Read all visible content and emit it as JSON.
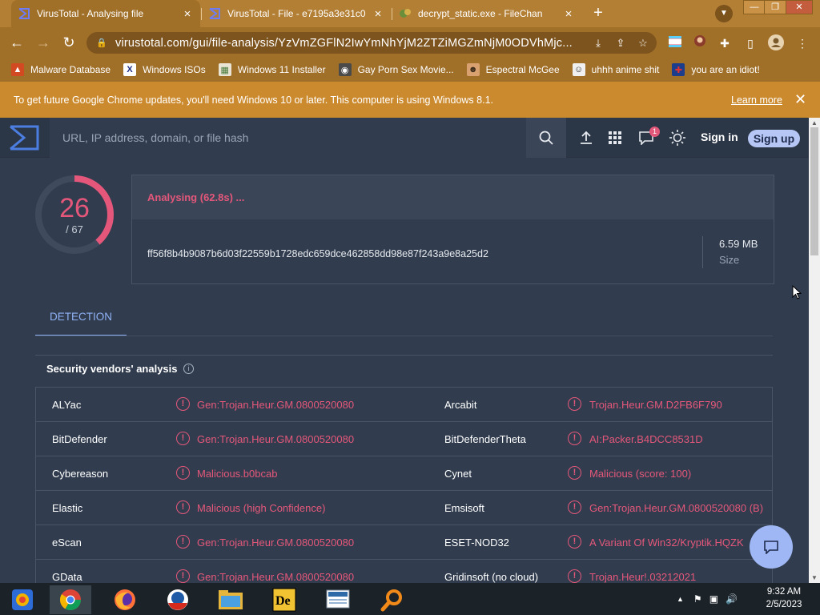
{
  "browser": {
    "tabs": [
      {
        "title": "VirusTotal - Analysing file",
        "close": "×"
      },
      {
        "title": "VirusTotal - File - e7195a3e31c0",
        "close": "×"
      },
      {
        "title": "decrypt_static.exe - FileChan",
        "close": "×"
      }
    ],
    "new_tab": "+",
    "window_controls": {
      "minimize": "—",
      "maximize": "❐",
      "close": "✕"
    },
    "address": "virustotal.com/gui/file-analysis/YzVmZGFlN2IwYmNhYjM2ZTZiMGZmNjM0ODVhMjc...",
    "bookmarks": [
      {
        "label": "Malware Database",
        "icon": "flame-icon"
      },
      {
        "label": "Windows ISOs",
        "icon": "x-icon"
      },
      {
        "label": "Windows 11 Installer",
        "icon": "image-icon"
      },
      {
        "label": "Gay Porn Sex Movie...",
        "icon": "site-icon"
      },
      {
        "label": "Espectral McGee",
        "icon": "face-icon"
      },
      {
        "label": "uhhh anime shit",
        "icon": "face-icon"
      },
      {
        "label": "you are an idiot!",
        "icon": "flag-icon"
      }
    ],
    "infobar": {
      "message": "To get future Google Chrome updates, you'll need Windows 10 or later. This computer is using Windows 8.1.",
      "learn_more": "Learn more",
      "close": "✕"
    }
  },
  "vt": {
    "search_placeholder": "URL, IP address, domain, or file hash",
    "notification_count": "1",
    "sign_in": "Sign in",
    "sign_up": "Sign up",
    "score": {
      "detected": "26",
      "total": "/ 67",
      "fraction": 0.388
    },
    "status": "Analysing (62.8s) ...",
    "hash": "ff56f8b4b9087b6d03f22559b1728edc659dce462858dd98e87f243a9e8a25d2",
    "size_value": "6.59 MB",
    "size_label": "Size",
    "tab_detection": "DETECTION",
    "vendors_title": "Security vendors' analysis",
    "rows": [
      {
        "v1": "ALYac",
        "r1": "Gen:Trojan.Heur.GM.0800520080",
        "v2": "Arcabit",
        "r2": "Trojan.Heur.GM.D2FB6F790"
      },
      {
        "v1": "BitDefender",
        "r1": "Gen:Trojan.Heur.GM.0800520080",
        "v2": "BitDefenderTheta",
        "r2": "AI:Packer.B4DCC8531D"
      },
      {
        "v1": "Cybereason",
        "r1": "Malicious.b0bcab",
        "v2": "Cynet",
        "r2": "Malicious (score: 100)"
      },
      {
        "v1": "Elastic",
        "r1": "Malicious (high Confidence)",
        "v2": "Emsisoft",
        "r2": "Gen:Trojan.Heur.GM.0800520080 (B)"
      },
      {
        "v1": "eScan",
        "r1": "Gen:Trojan.Heur.GM.0800520080",
        "v2": "ESET-NOD32",
        "r2": "A Variant Of Win32/Kryptik.HQZK"
      },
      {
        "v1": "GData",
        "r1": "Gen:Trojan.Heur.GM.0800520080",
        "v2": "Gridinsoft (no cloud)",
        "r2": "Trojan.Heur!.03212021"
      }
    ]
  },
  "taskbar": {
    "apps": [
      "google-photos-icon",
      "chrome-icon",
      "firefox-icon",
      "obama-logo-icon",
      "file-explorer-icon",
      "deluge-icon",
      "presentation-icon",
      "search-app-icon"
    ],
    "time": "9:32 AM",
    "date": "2/5/2023"
  },
  "colors": {
    "accent": "#b37f35",
    "danger": "#e5577a",
    "page_bg": "#313d4f"
  }
}
